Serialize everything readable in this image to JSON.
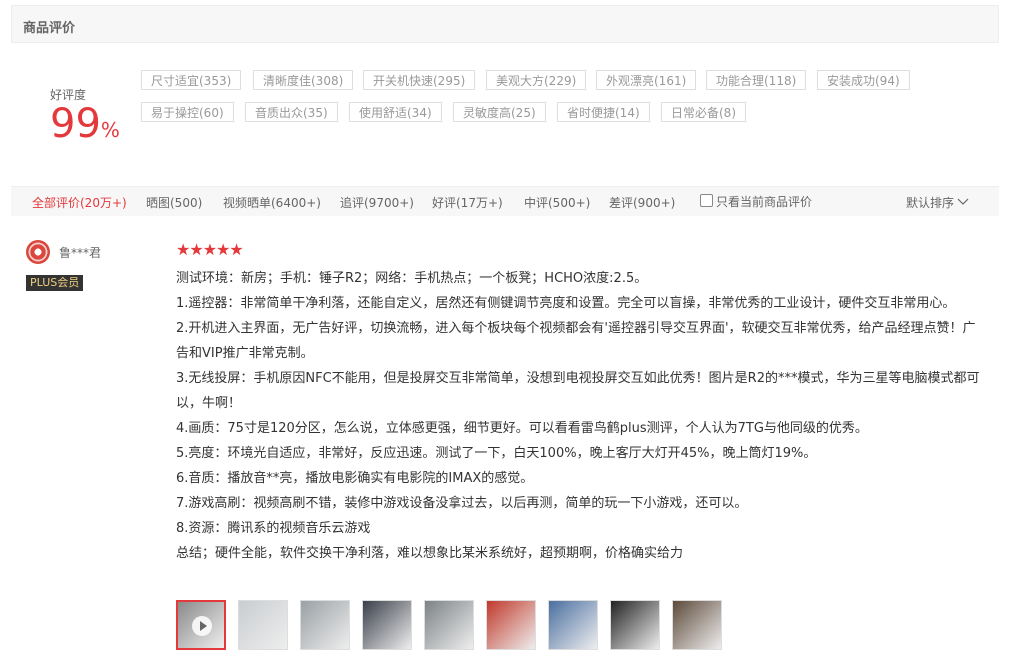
{
  "header": {
    "title": "商品评价"
  },
  "rating": {
    "label": "好评度",
    "value": "99",
    "unit": "%"
  },
  "tags": [
    {
      "label": "尺寸适宜(353)"
    },
    {
      "label": "清晰度佳(308)"
    },
    {
      "label": "开关机快速(295)"
    },
    {
      "label": "美观大方(229)"
    },
    {
      "label": "外观漂亮(161)"
    },
    {
      "label": "功能合理(118)"
    },
    {
      "label": "安装成功(94)"
    },
    {
      "label": "易于操控(60)"
    },
    {
      "label": "音质出众(35)"
    },
    {
      "label": "使用舒适(34)"
    },
    {
      "label": "灵敏度高(25)"
    },
    {
      "label": "省时便捷(14)"
    },
    {
      "label": "日常必备(8)"
    }
  ],
  "filters": [
    {
      "label": "全部评价(20万+)"
    },
    {
      "label": "晒图(500)"
    },
    {
      "label": "视频晒单(6400+)"
    },
    {
      "label": "追评(9700+)"
    },
    {
      "label": "好评(17万+)"
    },
    {
      "label": "中评(500+)"
    },
    {
      "label": "差评(900+)"
    }
  ],
  "current_only": "只看当前商品评价",
  "sort": {
    "label": "默认排序"
  },
  "review": {
    "user": "鲁***君",
    "badge": "PLUS会员",
    "stars": 5,
    "lines": [
      "测试环境：新房；手机：锤子R2；网络：手机热点；一个板凳；HCHO浓度:2.5。",
      "1.遥控器：非常简单干净利落，还能自定义，居然还有侧键调节亮度和设置。完全可以盲操，非常优秀的工业设计，硬件交互非常用心。",
      "2.开机进入主界面，无广告好评，切换流畅，进入每个板块每个视频都会有'遥控器引导交互界面'，软硬交互非常优秀，给产品经理点赞！广告和VIP推广非常克制。",
      "3.无线投屏：手机原因NFC不能用，但是投屏交互非常简单，没想到电视投屏交互如此优秀！图片是R2的***模式，华为三星等电脑模式都可以，牛啊！",
      "4.画质：75寸是120分区，怎么说，立体感更强，细节更好。可以看看雷鸟鹤plus测评，个人认为7TG与他同级的优秀。",
      "5.亮度：环境光自适应，非常好，反应迅速。测试了一下，白天100%，晚上客厅大灯开45%，晚上筒灯19%。",
      "6.音质：播放音**亮，播放电影确实有电影院的IMAX的感觉。",
      "7.游戏高刷：视频高刷不错，装修中游戏设备没拿过去，以后再测，简单的玩一下小游戏，还可以。",
      "8.资源：腾讯系的视频音乐云游戏",
      "总结；硬件全能，软件交换干净利落，难以想象比某米系统好，超预期啊，价格确实给力"
    ]
  },
  "thumbnails": [
    {
      "kind": "video",
      "color": "#8a8a8a"
    },
    {
      "kind": "photo",
      "color": "#c9cdd0"
    },
    {
      "kind": "photo",
      "color": "#9aa0a4"
    },
    {
      "kind": "photo",
      "color": "#3a3f4a"
    },
    {
      "kind": "photo",
      "color": "#7c8286"
    },
    {
      "kind": "photo",
      "color": "#c0392b"
    },
    {
      "kind": "photo",
      "color": "#4a6fa0"
    },
    {
      "kind": "photo",
      "color": "#222222"
    },
    {
      "kind": "photo",
      "color": "#5d4a3a"
    }
  ]
}
